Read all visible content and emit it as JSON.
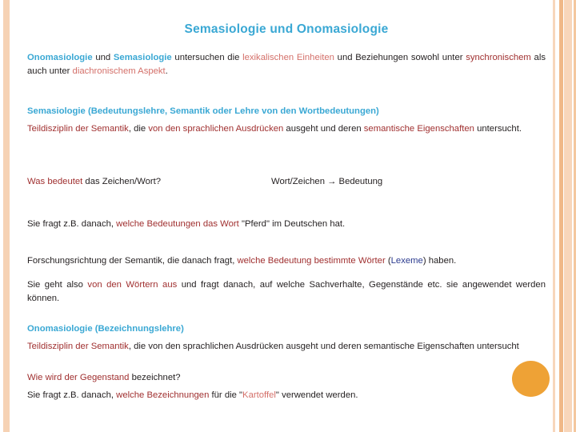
{
  "slide": {
    "title": "Semasiologie  und Onomasiologie",
    "decorations": {
      "circle_color": "#eea236",
      "stripe_color_light": "#f8d6ba",
      "stripe_color_dark": "#f0b887"
    },
    "colors": {
      "title_blue": "#3aa8d4",
      "heading_blue": "#3aa8d4",
      "highlight_salmon": "#d4706a",
      "highlight_dark_red": "#a03030",
      "accent_navy": "#2b3b8f",
      "body_black": "#231f20"
    },
    "intro": {
      "s1": "Onomasiologie",
      "s2": " und ",
      "s3": "Semasiologie",
      "s4": " untersuchen die ",
      "s5": "lexikalischen Einheiten",
      "s6": " und Beziehungen sowohl unter ",
      "s7": "synchronischem",
      "s8": " als auch unter ",
      "s9": "diachronischem Aspekt",
      "s10": "."
    },
    "semasiologie": {
      "heading": "Semasiologie (Bedeutungslehre, Semantik oder Lehre von den Wortbedeutungen)",
      "def_1": "Teildisziplin der Semantik",
      "def_2": ", die ",
      "def_3": "von den sprachlichen Ausdrücken",
      "def_4": " ausgeht und deren ",
      "def_5": "semantische Eigenschaften",
      "def_6": " untersucht.",
      "question_left_1": "Was bedeutet",
      "question_left_2": " das Zeichen/Wort?",
      "question_right": "Wort/Zeichen  →  Bedeutung",
      "example_1": "Sie fragt z.B. danach, ",
      "example_2": "welche Bedeutungen das Wort",
      "example_3": " \"Pferd\" im Deutschen hat."
    },
    "forschung": {
      "line_1": "Forschungsrichtung der Semantik, die danach fragt, ",
      "line_2": "welche Bedeutung bestimmte Wörter",
      "line_3": " (",
      "line_4": "Lexeme",
      "line_5": ") haben.",
      "geht_1": "Sie geht also ",
      "geht_2": "von den Wörtern aus",
      "geht_3": " und fragt danach, auf welche Sachverhalte, Gegenstände etc. sie angewendet werden können."
    },
    "onomasiologie": {
      "heading": "Onomasiologie (Bezeichnungslehre)",
      "def_1": "Teildisziplin der Semantik",
      "def_2": ", die von den sprachlichen Ausdrücken ausgeht und deren semantische Eigenschaften untersucht",
      "question_1": "Wie wird der Gegenstand",
      "question_2": " bezeichnet?",
      "example_1": "Sie fragt z.B. danach, ",
      "example_2": "welche Bezeichnungen",
      "example_3": " für die \"",
      "example_4": "Kartoffel",
      "example_5": "\" verwendet werden."
    }
  }
}
